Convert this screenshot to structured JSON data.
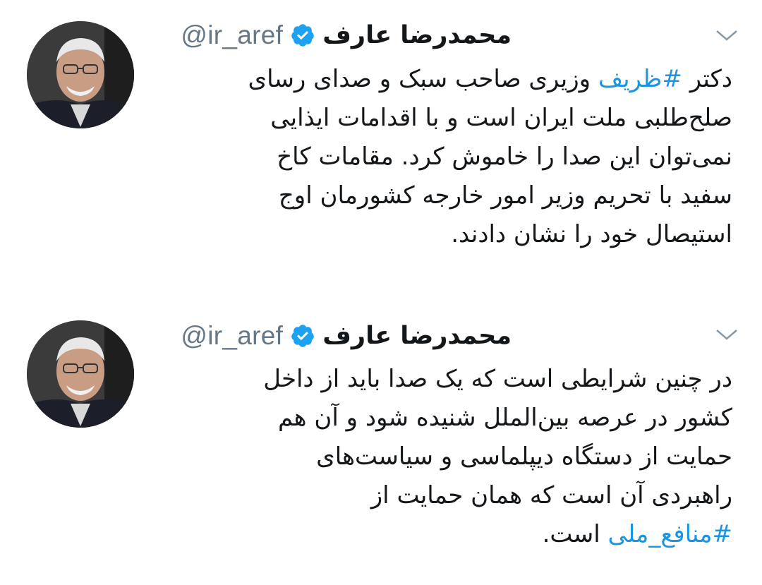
{
  "tweets": [
    {
      "author": {
        "display_name": "محمدرضا عارف",
        "handle": "@ir_aref",
        "verified_icon": "verified-badge-icon"
      },
      "menu_icon": "chevron-down-icon",
      "lines": [
        {
          "hashtag": "",
          "pre": "",
          "tag": "#ظریف",
          "post": "دکتر ",
          "after": " وزیری صاحب سبک و صدای رسای"
        },
        {
          "text": "صلح‌طلبی ملت ایران است و با اقدامات ایذایی"
        },
        {
          "text": "نمی‌توان این صدا را خاموش کرد. مقامات کاخ"
        },
        {
          "text": "سفید با تحریم وزیر امور خارجه کشورمان اوج"
        },
        {
          "text": "استیصال خود را نشان دادند."
        }
      ]
    },
    {
      "author": {
        "display_name": "محمدرضا عارف",
        "handle": "@ir_aref",
        "verified_icon": "verified-badge-icon"
      },
      "menu_icon": "chevron-down-icon",
      "lines": [
        {
          "text": "در چنین شرایطی است که یک صدا باید از داخل"
        },
        {
          "text": "کشور در عرصه بین‌الملل شنیده شود و آن هم"
        },
        {
          "text": "حمایت از دستگاه دیپلماسی و سیاست‌های"
        },
        {
          "text": "راهبردی آن است که همان حمایت از"
        },
        {
          "tag": "#منافع_ملی",
          "after": " است."
        }
      ]
    }
  ],
  "colors": {
    "hashtag": "#1b95e0",
    "verified": "#1da1f2",
    "handle": "#657786",
    "text": "#14171a"
  }
}
